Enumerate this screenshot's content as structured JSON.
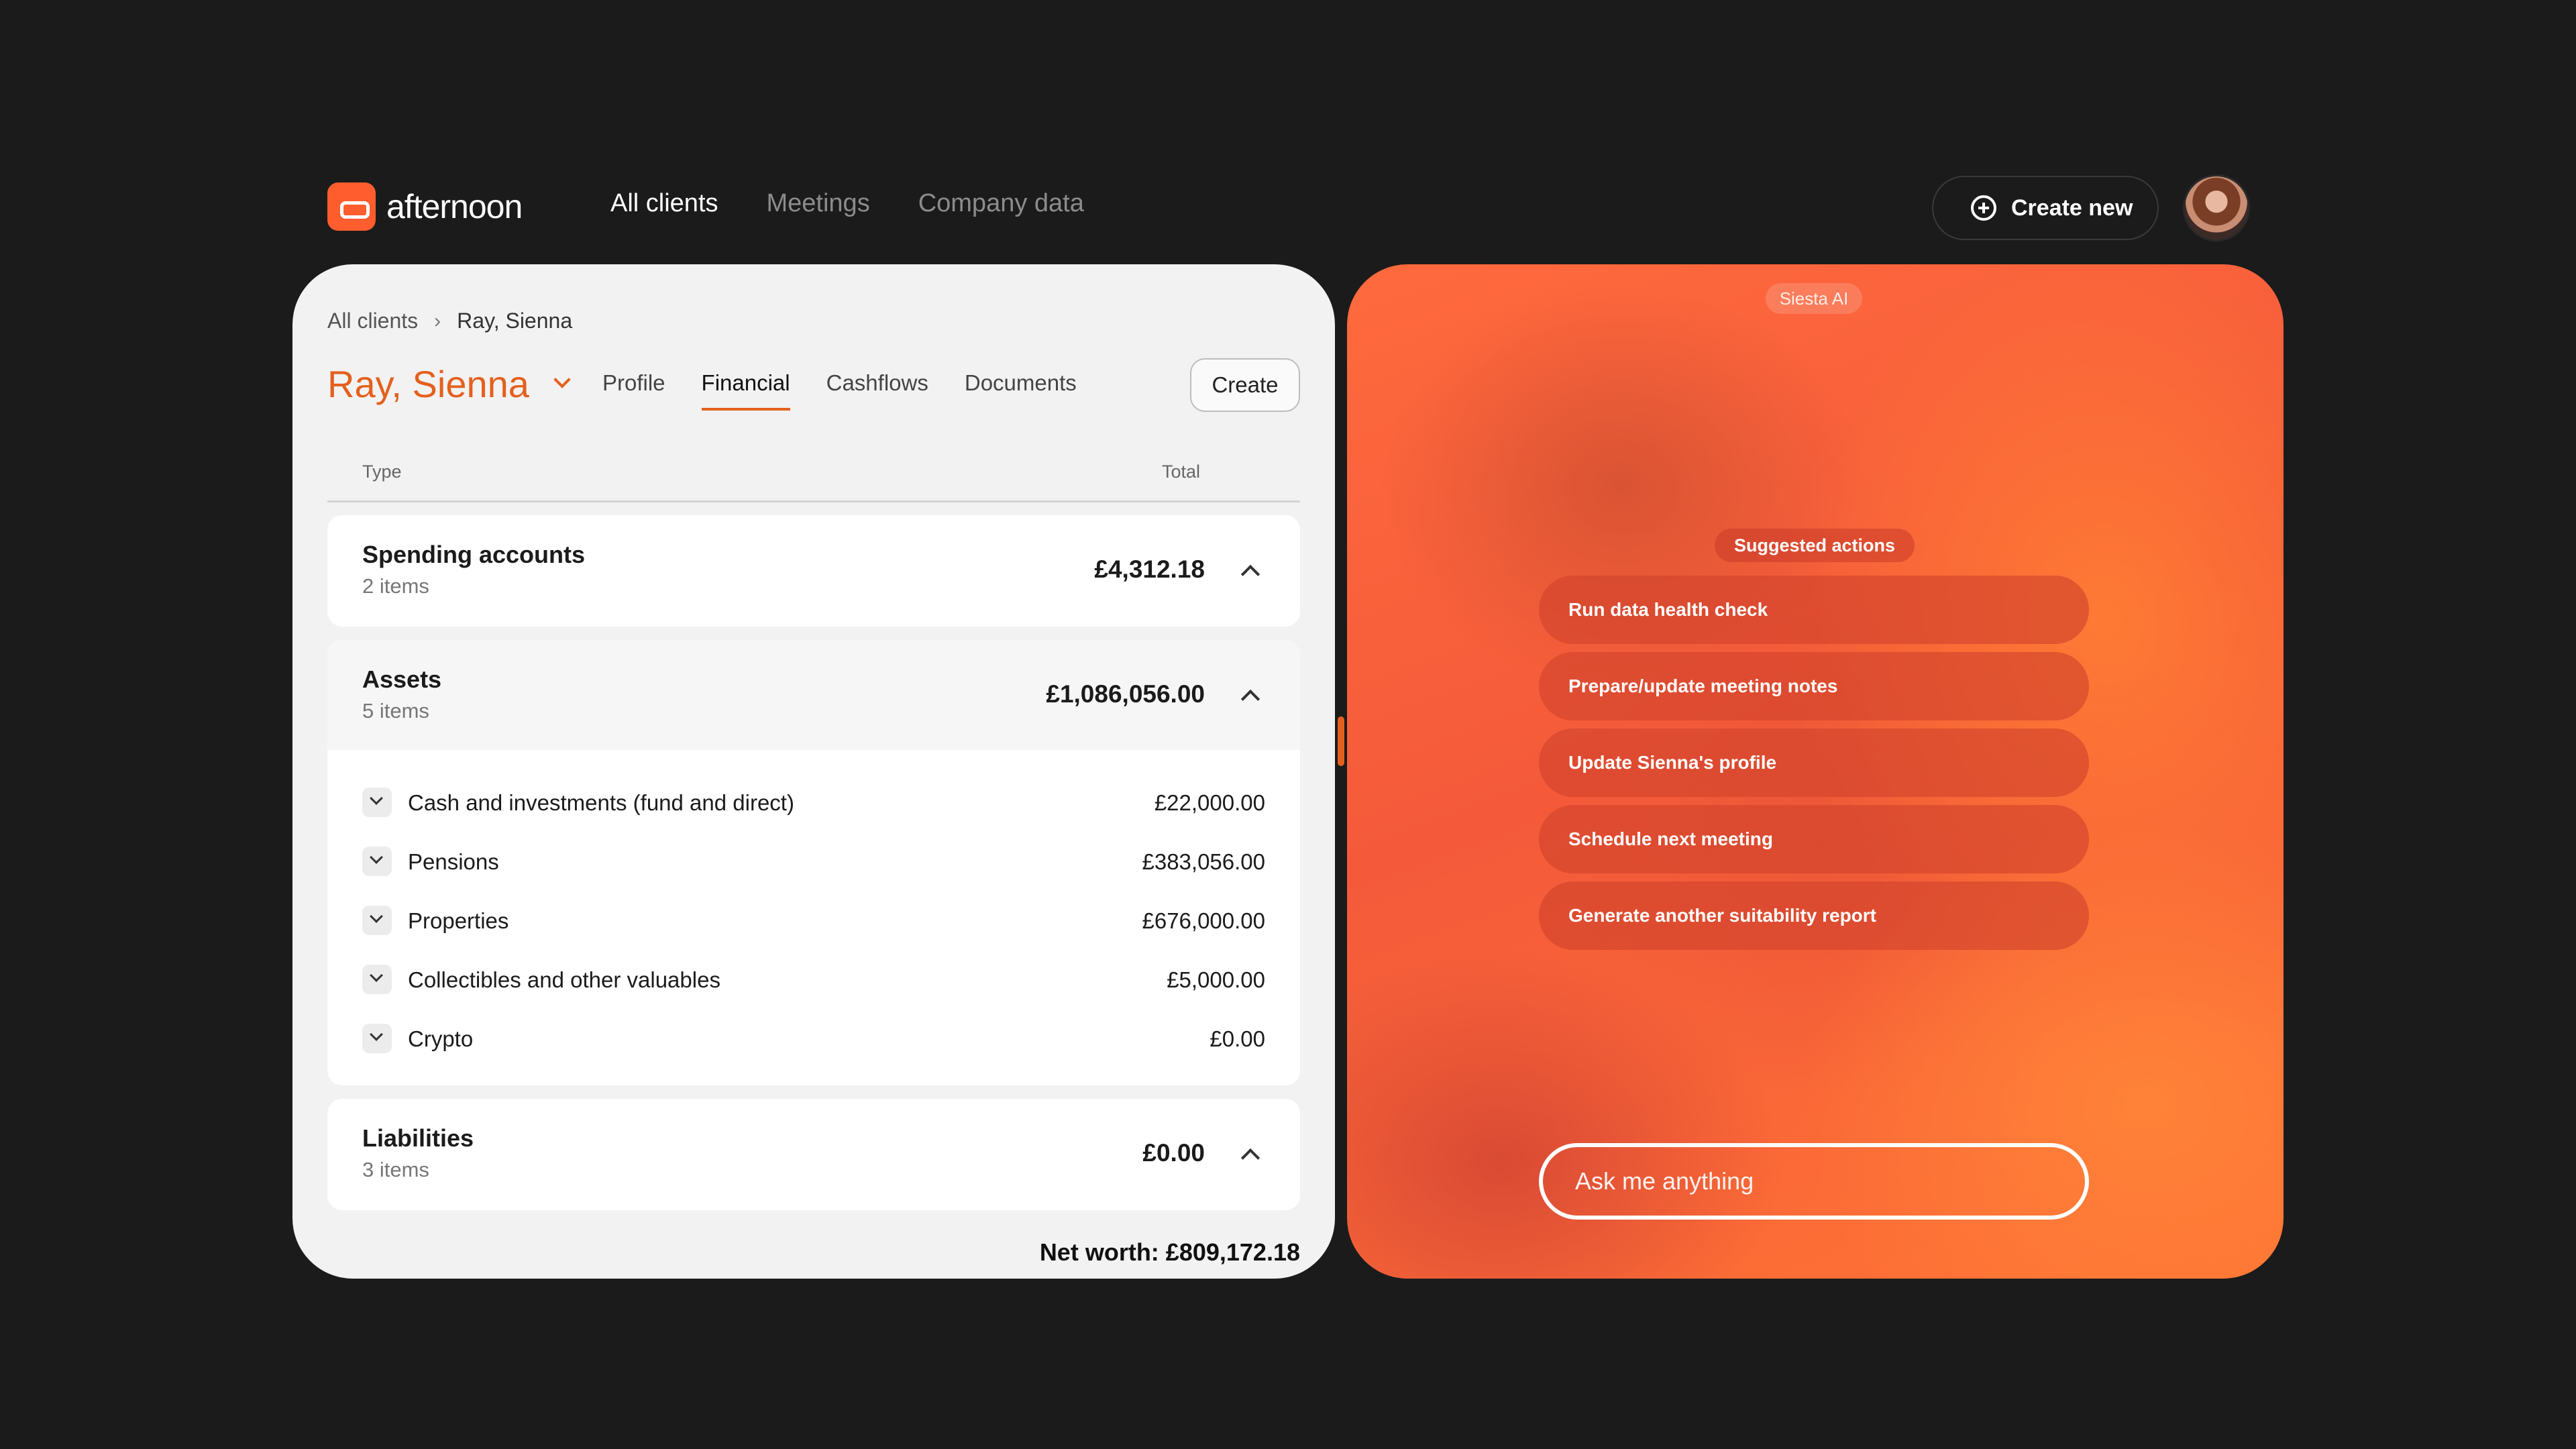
{
  "brand": {
    "name": "afternoon",
    "accent": "#e4601e",
    "logo_color": "#ff5d2e"
  },
  "nav": {
    "links": [
      {
        "label": "All clients",
        "active": true
      },
      {
        "label": "Meetings",
        "active": false
      },
      {
        "label": "Company data",
        "active": false
      }
    ],
    "create_new_label": "Create new",
    "create_new_icon": "plus-circle-icon",
    "avatar_icon": "user-avatar"
  },
  "breadcrumb": {
    "root": "All clients",
    "separator": "›",
    "current": "Ray, Sienna"
  },
  "client": {
    "name": "Ray, Sienna",
    "dropdown_icon": "chevron-down-icon"
  },
  "tabs": [
    {
      "label": "Profile",
      "active": false
    },
    {
      "label": "Financial",
      "active": true
    },
    {
      "label": "Cashflows",
      "active": false
    },
    {
      "label": "Documents",
      "active": false
    }
  ],
  "create_label": "Create",
  "table": {
    "col_type": "Type",
    "col_total": "Total",
    "groups": [
      {
        "title": "Spending accounts",
        "count": "2 items",
        "total": "£4,312.18",
        "expanded": false
      },
      {
        "title": "Assets",
        "count": "5 items",
        "total": "£1,086,056.00",
        "expanded": true,
        "rows": [
          {
            "label": "Cash and investments (fund and direct)",
            "value": "£22,000.00"
          },
          {
            "label": "Pensions",
            "value": "£383,056.00"
          },
          {
            "label": "Properties",
            "value": "£676,000.00"
          },
          {
            "label": "Collectibles and other valuables",
            "value": "£5,000.00"
          },
          {
            "label": "Crypto",
            "value": "£0.00"
          }
        ]
      },
      {
        "title": "Liabilities",
        "count": "3 items",
        "total": "£0.00",
        "expanded": false
      }
    ],
    "net_worth": "Net worth: £809,172.18"
  },
  "assistant": {
    "name": "Siesta AI",
    "suggested_label": "Suggested actions",
    "actions": [
      "Run data health check",
      "Prepare/update meeting notes",
      "Update Sienna's profile",
      "Schedule next meeting",
      "Generate another suitability report"
    ],
    "input_placeholder": "Ask me anything",
    "gradient_colors": [
      "#ff6a3d",
      "#f45a3a",
      "#ff7435"
    ]
  }
}
